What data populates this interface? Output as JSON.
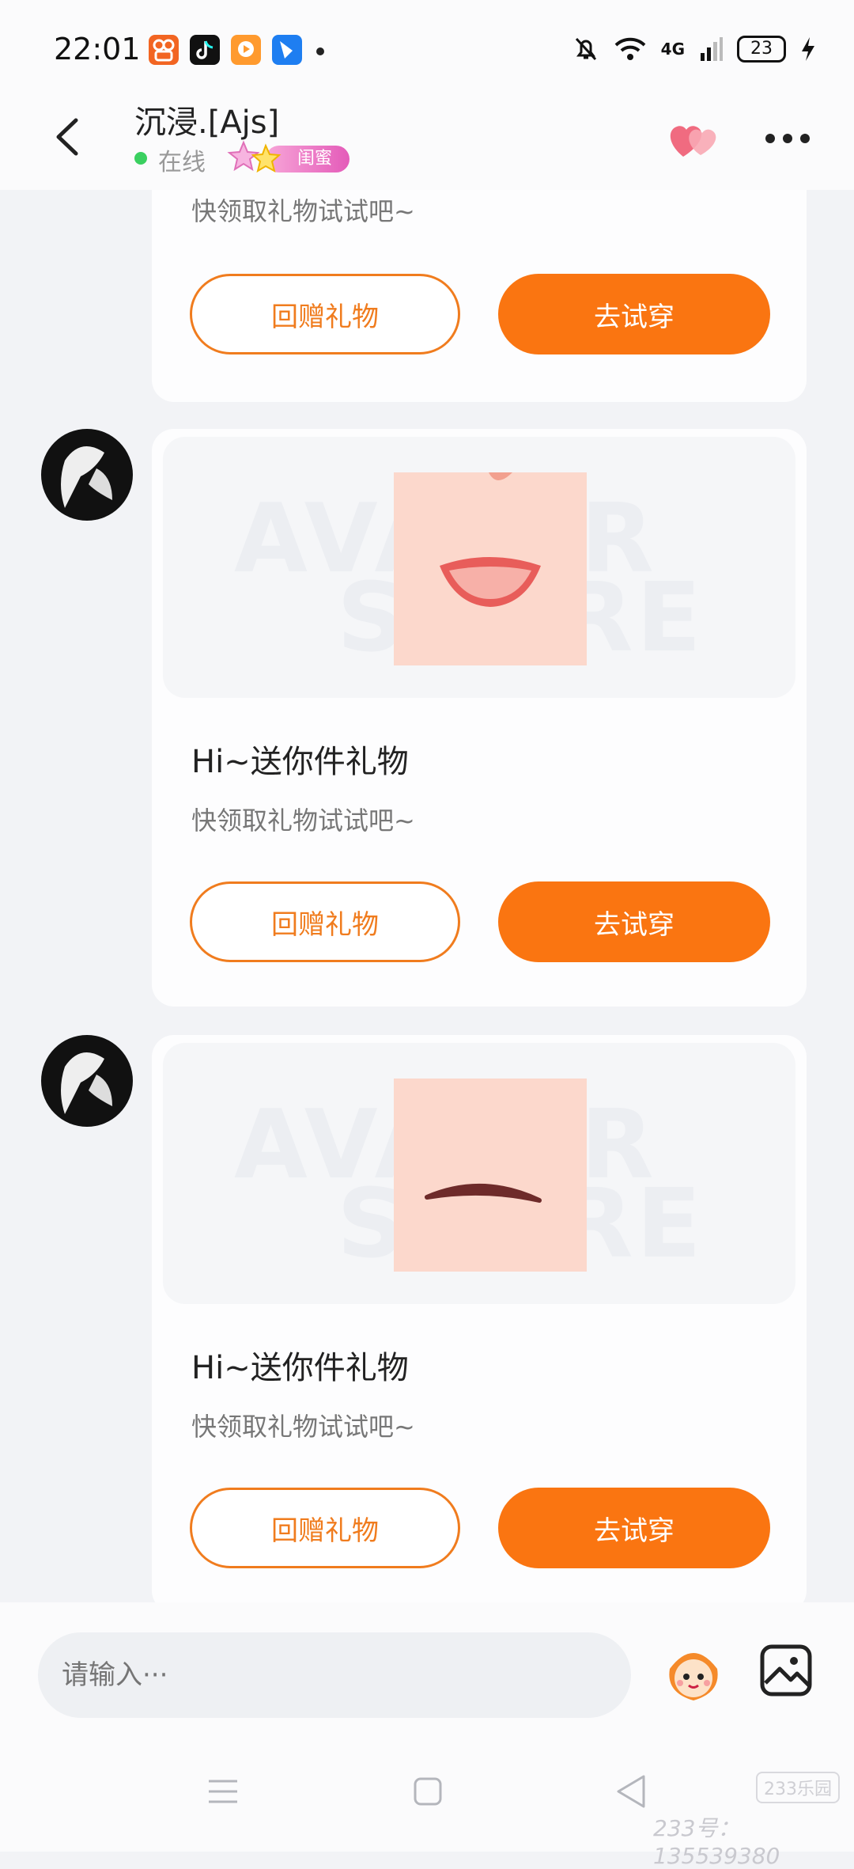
{
  "status_bar": {
    "time": "22:01",
    "network": "4G",
    "battery": "23",
    "icons": [
      "kuaishou-app-icon",
      "douyin-app-icon",
      "video-app-icon",
      "feishu-app-icon",
      "mute-bell-icon",
      "wifi-icon",
      "signal-icon",
      "charging-icon"
    ]
  },
  "header": {
    "title": "沉浸.[Ajs]",
    "online_status": "在线",
    "relationship_badge": "闺蜜",
    "icons": [
      "back-arrow-icon",
      "hearts-icon",
      "more-dots-icon"
    ]
  },
  "messages": [
    {
      "title": "",
      "subtitle": "快领取礼物试试吧~",
      "return_gift_label": "回赠礼物",
      "try_on_label": "去试穿"
    },
    {
      "title": "Hi~送你件礼物",
      "subtitle": "快领取礼物试试吧~",
      "return_gift_label": "回赠礼物",
      "try_on_label": "去试穿",
      "image_watermark": [
        "AVATAR",
        "STORE"
      ],
      "image_content": "mouth-smile"
    },
    {
      "title": "Hi~送你件礼物",
      "subtitle": "快领取礼物试试吧~",
      "return_gift_label": "回赠礼物",
      "try_on_label": "去试穿",
      "image_watermark": [
        "AVATAR",
        "STORE"
      ],
      "image_content": "eyebrow"
    }
  ],
  "input": {
    "placeholder": "请输入···"
  },
  "footer": {
    "brand_logo": "233乐园",
    "watermark": "233号：135539380"
  },
  "colors": {
    "accent": "#fa7511",
    "outline": "#f07c1e",
    "online": "#3ad060",
    "badge": "#e45bb9"
  }
}
